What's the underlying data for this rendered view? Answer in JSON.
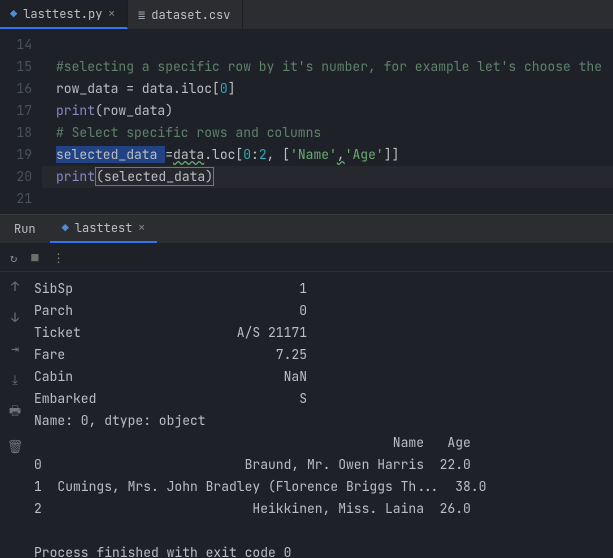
{
  "tabs": [
    {
      "label": "lasttest.py",
      "icon": "py",
      "active": true
    },
    {
      "label": "dataset.csv",
      "icon": "csv",
      "active": false
    }
  ],
  "gutter": [
    "14",
    "15",
    "16",
    "17",
    "18",
    "19",
    "20",
    "21"
  ],
  "code": {
    "l15_comment": "#selecting a specific row by it's number, for example let's choose the",
    "l16_a": "row_data ",
    "l16_b": "= data.",
    "l16_c": "iloc",
    "l16_d": "[",
    "l16_num": "0",
    "l16_e": "]",
    "l17_a": "print",
    "l17_b": "(row_data)",
    "l18_comment": "# Select specific rows and columns",
    "l19_a": "selected_data ",
    "l19_b": "=",
    "l19_c": "data",
    "l19_d": ".loc[",
    "l19_n1": "0",
    "l19_e": ":",
    "l19_n2": "2",
    "l19_f": ", [",
    "l19_s1": "'Name'",
    "l19_g": ",",
    "l19_s2": "'Age'",
    "l19_h": "]]",
    "l20_a": "print",
    "l20_b": "(",
    "l20_c": "selected_data",
    "l20_d": ")"
  },
  "run": {
    "label": "Run",
    "tab": "lasttest"
  },
  "console": "SibSp                             1\nParch                             0\nTicket                    A/S 21171\nFare                           7.25\nCabin                           NaN\nEmbarked                          S\nName: 0, dtype: object\n                                              Name   Age\n0                          Braund, Mr. Owen Harris  22.0\n1  Cumings, Mrs. John Bradley (Florence Briggs Th...  38.0\n2                           Heikkinen, Miss. Laina  26.0\n\nProcess finished with exit code 0"
}
